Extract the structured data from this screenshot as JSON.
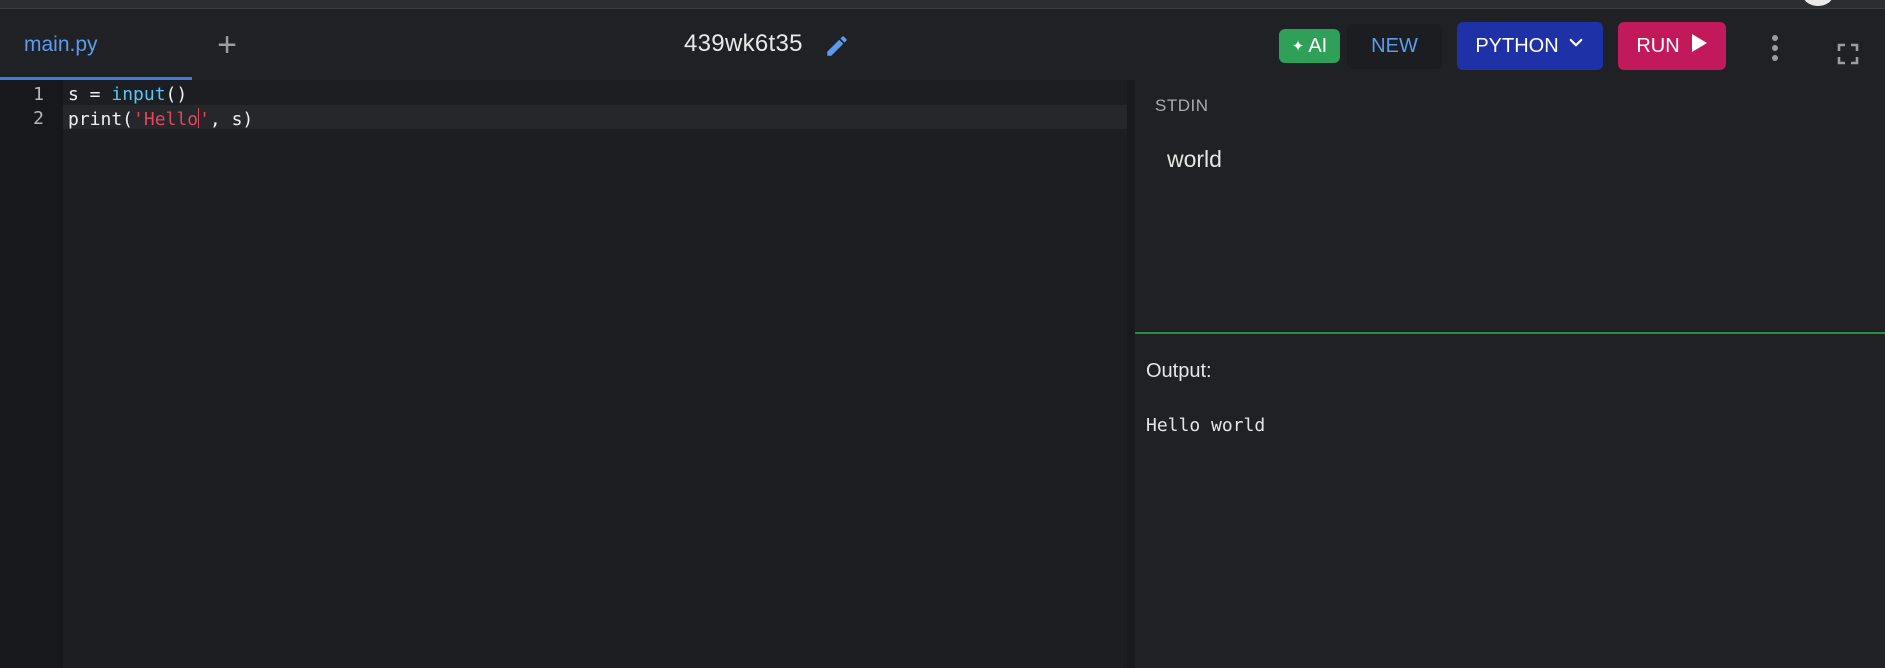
{
  "header": {
    "file_tab_label": "main.py",
    "add_tab_icon": "plus-icon",
    "title": "439wk6t35",
    "edit_icon": "pencil-icon",
    "ai_label": "AI",
    "ai_icon": "sparkles-icon",
    "new_label": "NEW",
    "language_label": "PYTHON",
    "language_icon": "chevron-down-icon",
    "run_label": "RUN",
    "run_icon": "play-icon",
    "more_icon": "vertical-dots-icon",
    "fullscreen_icon": "fullscreen-icon"
  },
  "editor": {
    "lines": [
      {
        "number": "1",
        "text": "s = input()"
      },
      {
        "number": "2",
        "text": "print('Hello', s)"
      }
    ],
    "tokens": {
      "line1_var": "s = ",
      "line1_call": "input",
      "line1_rest": "()",
      "line2_call": "print(",
      "line2_string": "'Hello",
      "line2_string_end": "'",
      "line2_rest": ", s)"
    }
  },
  "stdin": {
    "label": "STDIN",
    "value": "world"
  },
  "output": {
    "label": "Output:",
    "text": "Hello world"
  },
  "colors": {
    "background": "#202124",
    "accent_blue": "#5b9cf1",
    "ai_green": "#2ea057",
    "language_blue": "#1f31a6",
    "run_pink": "#c2195b",
    "keyword": "#5cc6f2",
    "string": "#e2465e",
    "divider_green": "#2e8b3a"
  }
}
